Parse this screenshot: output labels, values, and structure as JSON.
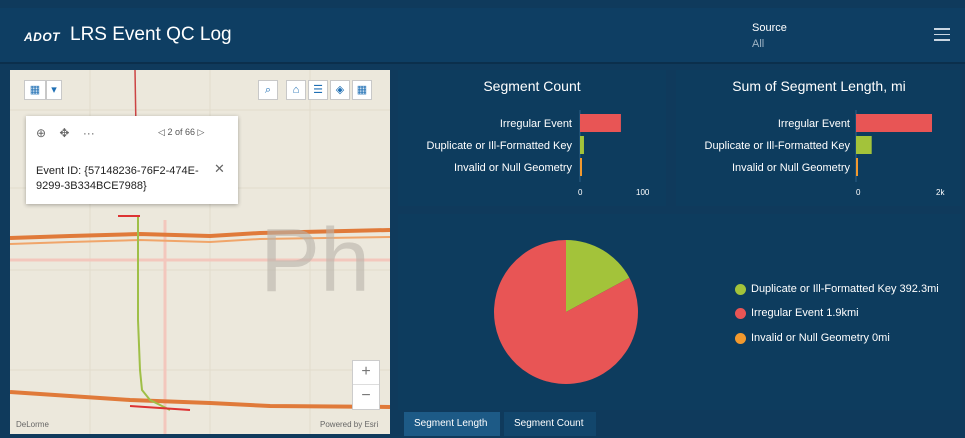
{
  "header": {
    "logo": "ADOT",
    "title": "LRS Event QC Log",
    "source_label": "Source",
    "source_value": "All"
  },
  "map": {
    "watermark": "Ph",
    "popup": {
      "pager": "2 of 66",
      "event_id": "Event ID: {57148236-76F2-474E-9299-3B334BCE7988}"
    },
    "zoom_in": "+",
    "zoom_out": "−",
    "attribution_left": "DeLorme",
    "attribution_right": "Powered by Esri"
  },
  "colors": {
    "irregular": "#e85555",
    "duplicate": "#a3c33a",
    "invalid": "#f2992e",
    "panel": "#0d3c5e",
    "background": "#0f3a5c"
  },
  "segment_count": {
    "title": "Segment Count",
    "categories": [
      "Irregular Event",
      "Duplicate or Ill-Formatted Key",
      "Invalid or Null Geometry"
    ],
    "values": [
      62,
      6,
      0
    ],
    "ticks": [
      "0",
      "100"
    ],
    "xlim": [
      0,
      100
    ]
  },
  "segment_length": {
    "title": "Sum of Segment Length, mi",
    "categories": [
      "Irregular Event",
      "Duplicate or Ill-Formatted Key",
      "Invalid or Null Geometry"
    ],
    "values": [
      1900,
      392.3,
      0
    ],
    "ticks": [
      "0",
      "2k"
    ],
    "xlim": [
      0,
      2000
    ]
  },
  "pie": {
    "legend": [
      {
        "label": "Duplicate or Ill-Formatted Key 392.3mi",
        "color": "#a3c33a"
      },
      {
        "label": "Irregular Event 1.9kmi",
        "color": "#e85555"
      },
      {
        "label": "Invalid or Null Geometry 0mi",
        "color": "#f2992e"
      }
    ]
  },
  "chart_data": [
    {
      "type": "bar",
      "title": "Segment Count",
      "categories": [
        "Irregular Event",
        "Duplicate or Ill-Formatted Key",
        "Invalid or Null Geometry"
      ],
      "values": [
        62,
        6,
        0
      ],
      "xlim": [
        0,
        100
      ]
    },
    {
      "type": "bar",
      "title": "Sum of Segment Length, mi",
      "categories": [
        "Irregular Event",
        "Duplicate or Ill-Formatted Key",
        "Invalid or Null Geometry"
      ],
      "values": [
        1900,
        392.3,
        0
      ],
      "xlim": [
        0,
        2000
      ]
    },
    {
      "type": "pie",
      "categories": [
        "Duplicate or Ill-Formatted Key",
        "Irregular Event",
        "Invalid or Null Geometry"
      ],
      "values": [
        392.3,
        1900,
        0
      ]
    }
  ],
  "tabs": [
    "Segment Length",
    "Segment Count"
  ]
}
